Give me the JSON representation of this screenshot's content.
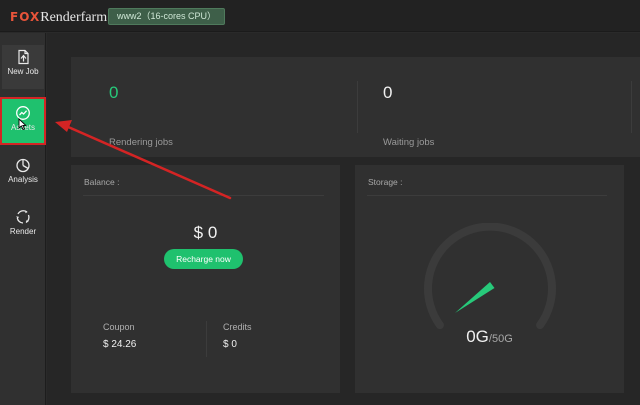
{
  "app": {
    "brand_prefix": "FOX",
    "brand_suffix": "Renderfarm",
    "server_badge": "www2（16-cores CPU）"
  },
  "sidebar": {
    "items": [
      {
        "label": "New Job",
        "icon": "new-job-icon"
      },
      {
        "label": "Assets",
        "icon": "assets-icon"
      },
      {
        "label": "Analysis",
        "icon": "analysis-icon"
      },
      {
        "label": "Render",
        "icon": "render-icon"
      }
    ],
    "active": "Assets"
  },
  "stats": {
    "rendering_value": "0",
    "rendering_label": "Rendering jobs",
    "waiting_value": "0",
    "waiting_label": "Waiting jobs"
  },
  "balance": {
    "title": "Balance :",
    "amount": "$ 0",
    "recharge_label": "Recharge now",
    "coupon_label": "Coupon",
    "coupon_value": "$ 24.26",
    "credits_label": "Credits",
    "credits_value": "$ 0"
  },
  "storage": {
    "title": "Storage :",
    "used": "0G",
    "total": "/50G",
    "used_fraction": 0
  },
  "colors": {
    "accent_green": "#1fc16e",
    "highlight_red": "#d42424",
    "brand_orange": "#e8543a"
  }
}
